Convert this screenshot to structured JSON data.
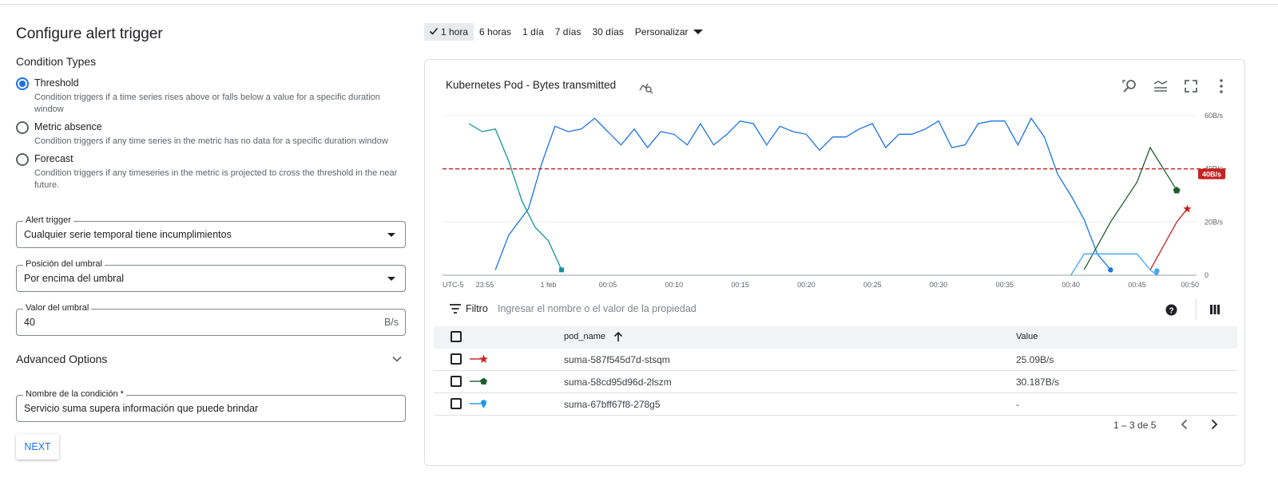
{
  "form": {
    "title": "Configure alert trigger",
    "condition_types_label": "Condition Types",
    "conditions": [
      {
        "label": "Threshold",
        "description": "Condition triggers if a time series rises above or falls below a value for a specific duration window",
        "selected": true
      },
      {
        "label": "Metric absence",
        "description": "Condition triggers if any time series in the metric has no data for a specific duration window",
        "selected": false
      },
      {
        "label": "Forecast",
        "description": "Condition triggers if any timeseries in the metric is projected to cross the threshold in the near future.",
        "selected": false
      }
    ],
    "alert_trigger": {
      "label": "Alert trigger",
      "value": "Cualquier serie temporal tiene incumplimientos"
    },
    "threshold_position": {
      "label": "Posición del umbral",
      "value": "Por encima del umbral"
    },
    "threshold_value": {
      "label": "Valor del umbral",
      "value": "40",
      "unit": "B/s"
    },
    "advanced_options": "Advanced Options",
    "condition_name": {
      "label": "Nombre de la condición *",
      "value": "Servicio suma supera información que puede brindar"
    },
    "next_button": "NEXT"
  },
  "time_range": {
    "options": [
      "1 hora",
      "6 horas",
      "1 día",
      "7 días",
      "30 días"
    ],
    "selected": "1 hora",
    "custom": "Personalizar"
  },
  "chart": {
    "title": "Kubernetes Pod - Bytes transmitted",
    "filter_label": "Filtro",
    "filter_placeholder": "Ingresar el nombre o el valor de la propiedad",
    "table_headers": {
      "pod": "pod_name",
      "value": "Value"
    },
    "rows": [
      {
        "pod": "suma-587f545d7d-stsqm",
        "value": "25.09B/s",
        "color": "#c5221f",
        "marker": "star"
      },
      {
        "pod": "suma-58cd95d96d-2lszm",
        "value": "30.187B/s",
        "color": "#1e5e2f",
        "marker": "pentagon"
      },
      {
        "pod": "suma-67bff67f8-278g5",
        "value": "-",
        "color": "#1a9be8",
        "marker": "pin"
      }
    ],
    "pagination": "1 – 3 de 5"
  },
  "chart_data": {
    "type": "line",
    "x_ticks": [
      "UTC-5",
      "23:55",
      "1 feb",
      "00:05",
      "00:10",
      "00:15",
      "00:20",
      "00:25",
      "00:30",
      "00:35",
      "00:40",
      "00:45",
      "00:50"
    ],
    "y_ticks": [
      "60B/s",
      "40B/s",
      "20B/s",
      "0"
    ],
    "ylim": [
      0,
      60
    ],
    "threshold": {
      "value": 40,
      "label": "40B/s",
      "color": "#c5221f"
    },
    "series": [
      {
        "color": "#1a73e8",
        "marker": "circle",
        "points": [
          [
            -3.5,
            2
          ],
          [
            -2.5,
            15
          ],
          [
            -1,
            25
          ],
          [
            0,
            42
          ],
          [
            1,
            56
          ],
          [
            2,
            54
          ],
          [
            3,
            55
          ],
          [
            4,
            59
          ],
          [
            5,
            54
          ],
          [
            6,
            49
          ],
          [
            7,
            55
          ],
          [
            8,
            48
          ],
          [
            9,
            54
          ],
          [
            10,
            53
          ],
          [
            11,
            49
          ],
          [
            12,
            57
          ],
          [
            13,
            49
          ],
          [
            14,
            53
          ],
          [
            15,
            58
          ],
          [
            16,
            57
          ],
          [
            17,
            49
          ],
          [
            18,
            56
          ],
          [
            19,
            54
          ],
          [
            20,
            53
          ],
          [
            21,
            47
          ],
          [
            22,
            52
          ],
          [
            23,
            52
          ],
          [
            24,
            55
          ],
          [
            25,
            57
          ],
          [
            26,
            48
          ],
          [
            27,
            53
          ],
          [
            28,
            53
          ],
          [
            29,
            55
          ],
          [
            30,
            58
          ],
          [
            31,
            48
          ],
          [
            32,
            49
          ],
          [
            33,
            57
          ],
          [
            34,
            58
          ],
          [
            35,
            58
          ],
          [
            36,
            49
          ],
          [
            37,
            59
          ],
          [
            38,
            52
          ],
          [
            39,
            38
          ],
          [
            40,
            30
          ],
          [
            41,
            21
          ],
          [
            42,
            8
          ],
          [
            43,
            2
          ]
        ]
      },
      {
        "color": "#12939a",
        "marker": "square",
        "points": [
          [
            -5.5,
            57
          ],
          [
            -4.5,
            54
          ],
          [
            -3.5,
            55
          ],
          [
            -2.5,
            43
          ],
          [
            -1.5,
            28
          ],
          [
            -0.5,
            18
          ],
          [
            0.5,
            13
          ],
          [
            1.5,
            2
          ]
        ]
      },
      {
        "color": "#1e5e2f",
        "marker": "pentagon",
        "points": [
          [
            41,
            2
          ],
          [
            43,
            20
          ],
          [
            45,
            35
          ],
          [
            46,
            48
          ],
          [
            47,
            40
          ],
          [
            48,
            32
          ]
        ]
      },
      {
        "color": "#c5221f",
        "marker": "star",
        "points": [
          [
            46,
            2
          ],
          [
            48,
            20
          ],
          [
            48.8,
            25
          ]
        ]
      },
      {
        "color": "#42a5f5",
        "marker": "pin",
        "points": [
          [
            40,
            0
          ],
          [
            41,
            8
          ],
          [
            42,
            8
          ],
          [
            43,
            8
          ],
          [
            45,
            8
          ],
          [
            46,
            2
          ],
          [
            46.5,
            0
          ]
        ]
      }
    ]
  }
}
